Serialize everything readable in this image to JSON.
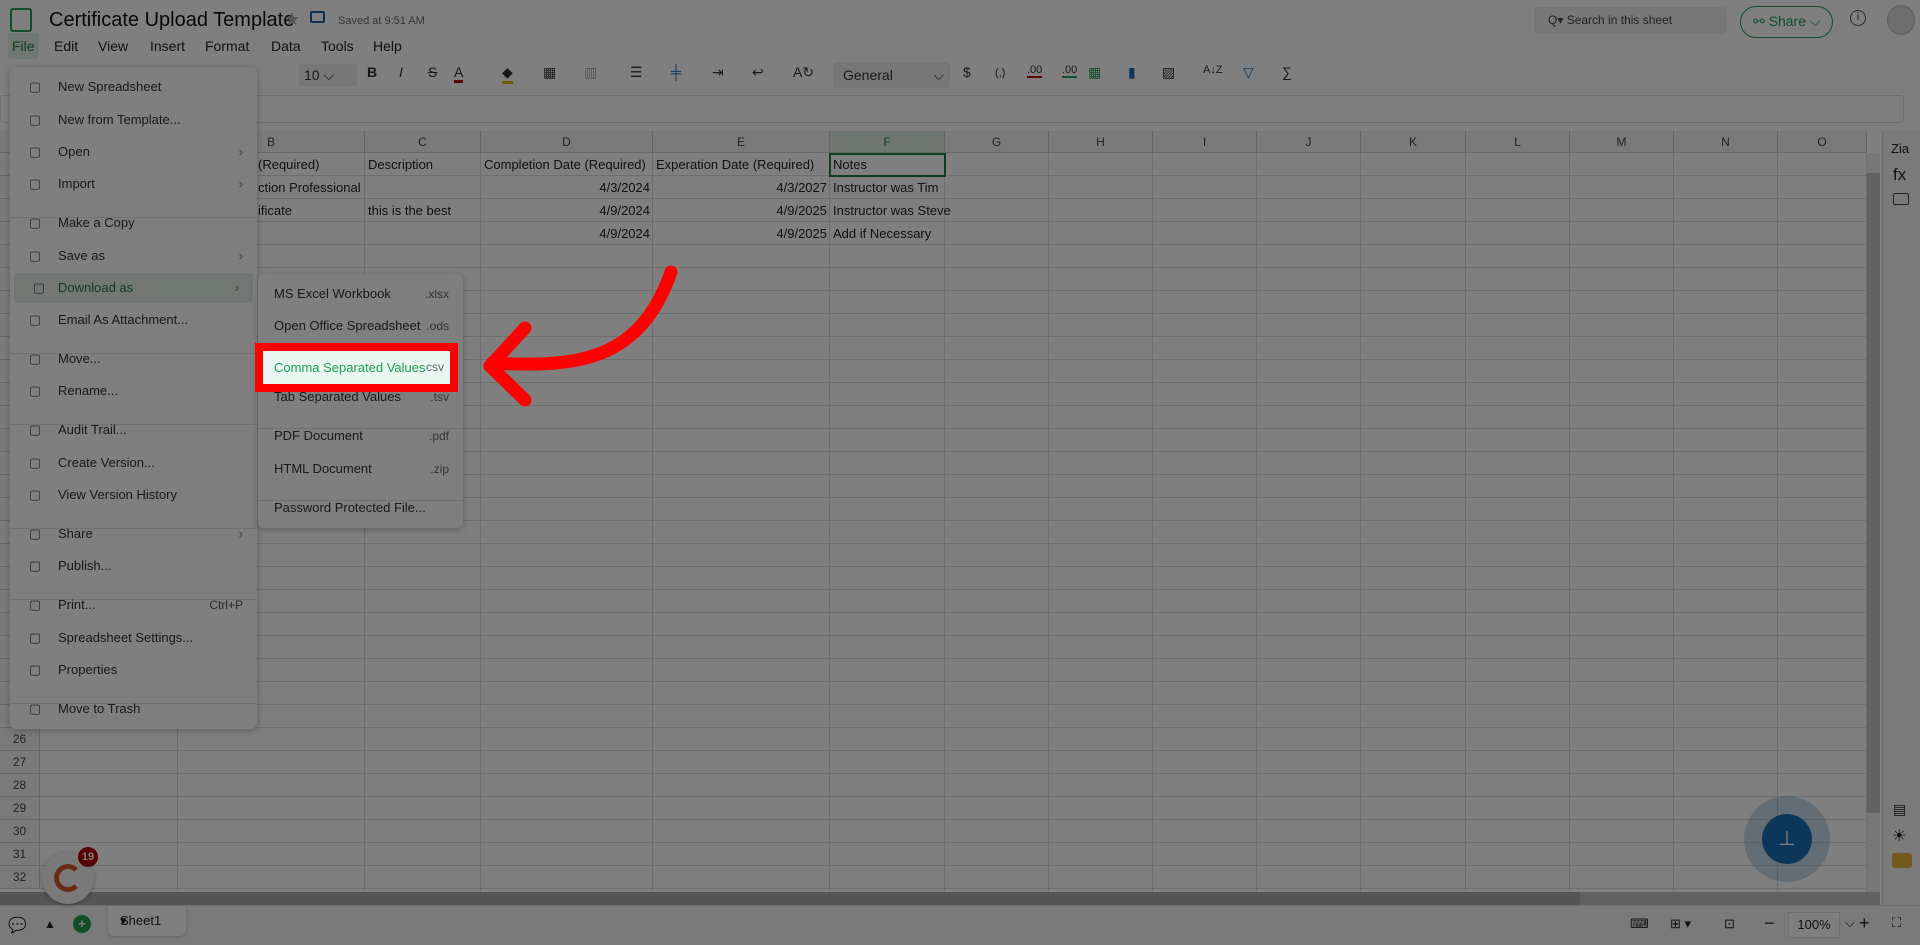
{
  "app": {
    "title": "Certificate Upload Template",
    "saved": "Saved at 9:51 AM",
    "search_placeholder": "Search in this sheet",
    "share": "Share"
  },
  "menubar": [
    "File",
    "Edit",
    "View",
    "Insert",
    "Format",
    "Data",
    "Tools",
    "Help"
  ],
  "toolbar": {
    "font_size": "10",
    "bold": "B",
    "italic": "I",
    "strike": "S",
    "font_color": "A",
    "number_format": "General",
    "currency": "$",
    "comma": "(,)",
    "dec_dec": ".00",
    "inc_dec": ".00",
    "font_color_hex": "#c00000",
    "fill_color_hex": "#d4c000"
  },
  "columns": [
    "B",
    "C",
    "D",
    "E",
    "F",
    "G",
    "H",
    "I",
    "J",
    "K",
    "L",
    "M",
    "N",
    "O"
  ],
  "rows": [
    {
      "B": "(Required)",
      "C": "Description",
      "D": "Completion Date (Required)",
      "E": "Experation Date (Required)",
      "F": "Notes"
    },
    {
      "B": "ction Professional",
      "C": "",
      "D": "4/3/2024",
      "E": "4/3/2027",
      "F": "Instructor was Tim"
    },
    {
      "B": "ificate",
      "C": "this is the best",
      "D": "4/9/2024",
      "E": "4/9/2025",
      "F": "Instructor was Steve"
    },
    {
      "B": "",
      "C": "",
      "D": "4/9/2024",
      "E": "4/9/2025",
      "F": "Add if Necessary"
    }
  ],
  "row_numbers": [
    "26",
    "27",
    "28",
    "29",
    "30",
    "31",
    "32"
  ],
  "file_menu": [
    {
      "label": "New Spreadsheet",
      "icon": "spreadsheet-icon"
    },
    {
      "label": "New from Template...",
      "icon": "template-icon"
    },
    {
      "label": "Open",
      "icon": "open-icon",
      "sub": true
    },
    {
      "label": "Import",
      "icon": "import-icon",
      "sub": true
    },
    {
      "label": "Make a Copy",
      "icon": "copy-icon",
      "sep": true
    },
    {
      "label": "Save as",
      "icon": "save-icon",
      "sub": true
    },
    {
      "label": "Download as",
      "icon": "download-icon",
      "sub": true,
      "active": true
    },
    {
      "label": "Email As Attachment...",
      "icon": "email-icon"
    },
    {
      "label": "Move...",
      "icon": "move-icon",
      "sep": true
    },
    {
      "label": "Rename...",
      "icon": "rename-icon"
    },
    {
      "label": "Audit Trail...",
      "icon": "audit-icon",
      "sep": true
    },
    {
      "label": "Create Version...",
      "icon": "version-icon"
    },
    {
      "label": "View Version History",
      "icon": "history-icon"
    },
    {
      "label": "Share",
      "icon": "share-icon",
      "sub": true,
      "sep": true
    },
    {
      "label": "Publish...",
      "icon": "globe-icon"
    },
    {
      "label": "Print...",
      "icon": "print-icon",
      "shortcut": "Ctrl+P",
      "sep": true
    },
    {
      "label": "Spreadsheet Settings...",
      "icon": "gear-icon"
    },
    {
      "label": "Properties",
      "icon": "info-icon"
    },
    {
      "label": "Move to Trash",
      "icon": "trash-icon",
      "sep": true
    }
  ],
  "download_menu": [
    {
      "label": "MS Excel Workbook",
      "ext": ".xlsx"
    },
    {
      "label": "Open Office Spreadsheet",
      "ext": ".ods"
    },
    {
      "label": "Comma Separated Values",
      "ext": ".csv",
      "highlighted": true
    },
    {
      "label": "Tab Separated Values",
      "ext": ".tsv"
    },
    {
      "label": "PDF Document",
      "ext": ".pdf",
      "sep": true
    },
    {
      "label": "HTML Document",
      "ext": ".zip"
    },
    {
      "label": "Password Protected File...",
      "ext": "",
      "sep": true
    }
  ],
  "bottom": {
    "sheet": "Sheet1",
    "zoom": "100%",
    "notification_count": "19"
  },
  "colors": {
    "accent": "#1e9e57",
    "highlight": "#ff0000",
    "fab": "#1a6fb5"
  }
}
